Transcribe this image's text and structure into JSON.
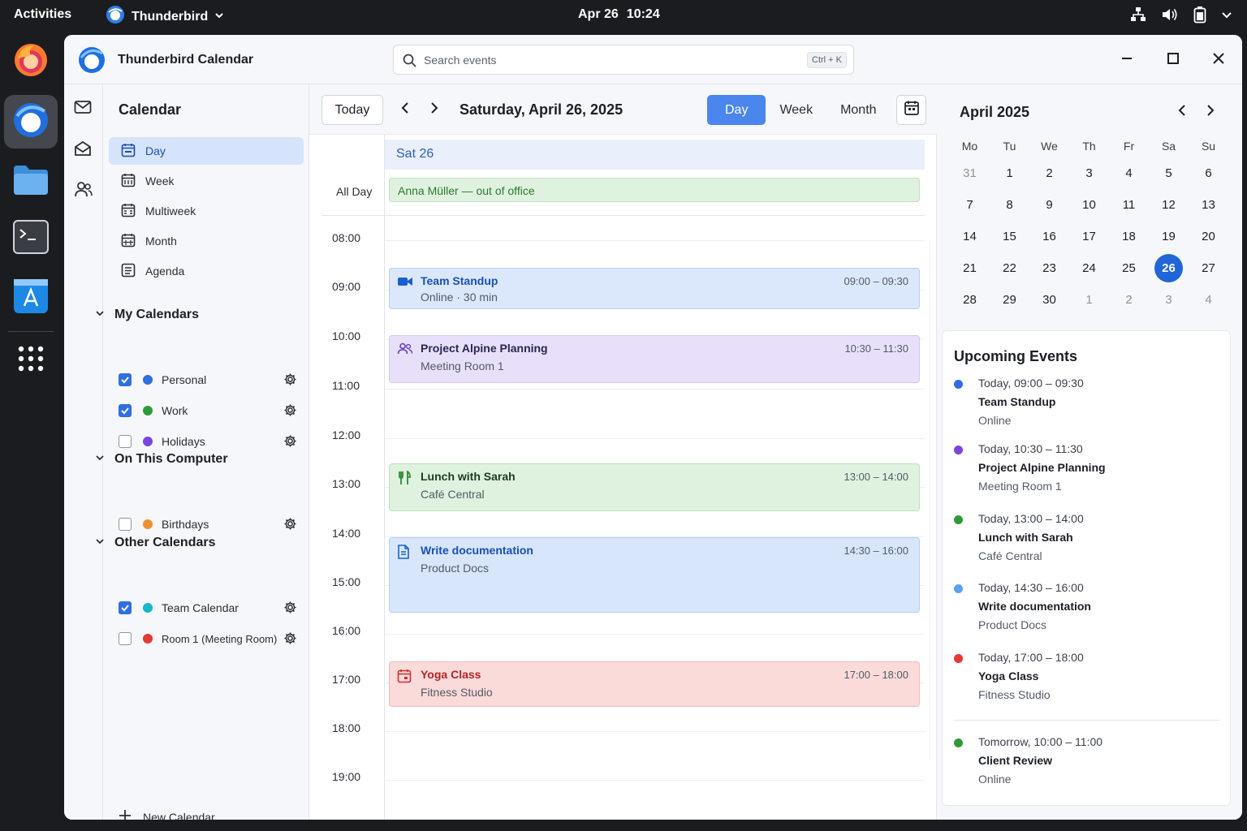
{
  "topbar": {
    "activities": "Activities",
    "app_name": "Thunderbird",
    "date": "Apr 26",
    "time": "10:24"
  },
  "window": {
    "title": "Thunderbird Calendar",
    "search_placeholder": "Search events",
    "search_shortcut": "Ctrl + K"
  },
  "leftpane": {
    "title": "Calendar",
    "views": [
      {
        "label": "Day",
        "selected": true
      },
      {
        "label": "Week"
      },
      {
        "label": "Multiweek"
      },
      {
        "label": "Month"
      },
      {
        "label": "Agenda"
      }
    ],
    "sections": [
      {
        "title": "My Calendars",
        "calendars": [
          {
            "name": "Personal",
            "checked": true,
            "color": "#2f6fdf"
          },
          {
            "name": "Work",
            "checked": true,
            "color": "#2f9a3a"
          },
          {
            "name": "Holidays",
            "checked": false,
            "color": "#7a45e0"
          }
        ]
      },
      {
        "title": "On This Computer",
        "calendars": [
          {
            "name": "Birthdays",
            "checked": false,
            "color": "#f09030"
          }
        ]
      },
      {
        "title": "Other Calendars",
        "calendars": [
          {
            "name": "Team Calendar",
            "checked": true,
            "color": "#18b8c8"
          },
          {
            "name": "Room 1 (Meeting Room)",
            "checked": false,
            "color": "#e53935"
          }
        ]
      }
    ],
    "new_calendar": "New Calendar"
  },
  "toolbar": {
    "today": "Today",
    "date_title": "Saturday, April 26, 2025",
    "view_day": "Day",
    "view_week": "Week",
    "view_month": "Month"
  },
  "dayview": {
    "day_header": "Sat 26",
    "allday_label": "All Day",
    "allday_event": "Anna Müller — out of office",
    "hours": [
      "08:00",
      "09:00",
      "10:00",
      "11:00",
      "12:00",
      "13:00",
      "14:00",
      "15:00",
      "16:00",
      "17:00",
      "18:00",
      "19:00"
    ],
    "events": [
      {
        "title": "Team Standup",
        "sub": "Online · 30 min",
        "time": "09:00 – 09:30",
        "icon": "video-icon"
      },
      {
        "title": "Project Alpine Planning",
        "sub": "Meeting Room 1",
        "time": "10:30 – 11:30",
        "icon": "people-icon"
      },
      {
        "title": "Lunch with Sarah",
        "sub": "Café Central",
        "time": "13:00 – 14:00",
        "icon": "utensils-icon"
      },
      {
        "title": "Write documentation",
        "sub": "Product Docs",
        "time": "14:30 – 16:00",
        "icon": "document-icon"
      },
      {
        "title": "Yoga Class",
        "sub": "Fitness Studio",
        "time": "17:00 – 18:00",
        "icon": "calendar-event-icon"
      }
    ]
  },
  "minicalendar": {
    "title": "April 2025",
    "weekdays": [
      "Mo",
      "Tu",
      "We",
      "Th",
      "Fr",
      "Sa",
      "Su"
    ],
    "weeks": [
      [
        "31",
        "1",
        "2",
        "3",
        "4",
        "5",
        "6"
      ],
      [
        "7",
        "8",
        "9",
        "10",
        "11",
        "12",
        "13"
      ],
      [
        "14",
        "15",
        "16",
        "17",
        "18",
        "19",
        "20"
      ],
      [
        "21",
        "22",
        "23",
        "24",
        "25",
        "26",
        "27"
      ],
      [
        "28",
        "29",
        "30",
        "1",
        "2",
        "3",
        "4"
      ]
    ],
    "today": "26"
  },
  "upcoming": {
    "title": "Upcoming Events",
    "items": [
      {
        "time": "Today, 09:00 – 09:30",
        "name": "Team Standup",
        "location": "Online",
        "color": "#2f6fdf"
      },
      {
        "time": "Today, 10:30 – 11:30",
        "name": "Project Alpine Planning",
        "location": "Meeting Room 1",
        "color": "#7a45e0"
      },
      {
        "time": "Today, 13:00 – 14:00",
        "name": "Lunch with Sarah",
        "location": "Café Central",
        "color": "#2f9a3a"
      },
      {
        "time": "Today, 14:30 – 16:00",
        "name": "Write documentation",
        "location": "Product Docs",
        "color": "#5ea0f0"
      },
      {
        "time": "Today, 17:00 – 18:00",
        "name": "Yoga Class",
        "location": "Fitness Studio",
        "color": "#e53935"
      },
      {
        "time": "Tomorrow, 10:00 – 11:00",
        "name": "Client Review",
        "location": "Online",
        "color": "#2f9a3a"
      }
    ]
  }
}
